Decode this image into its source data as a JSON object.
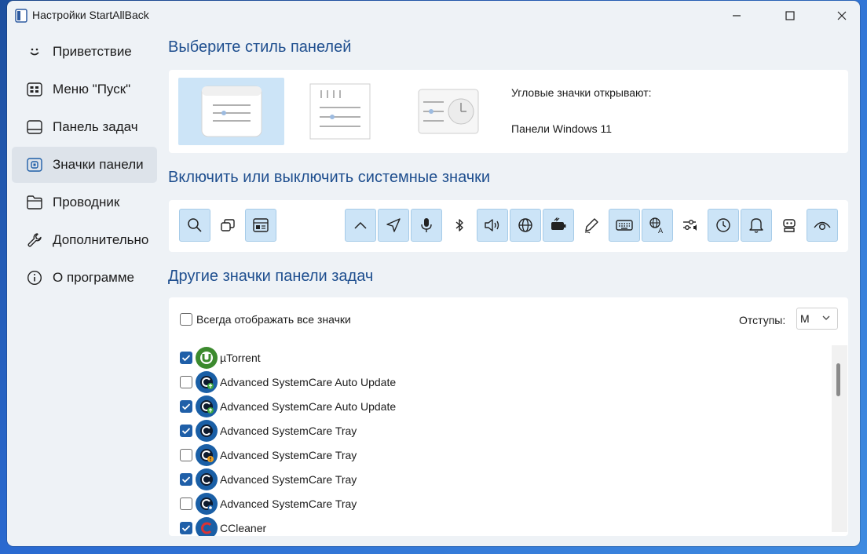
{
  "window": {
    "title": "Настройки StartAllBack"
  },
  "sidebar": {
    "items": [
      {
        "label": "Приветствие",
        "icon": "smile-icon",
        "active": false
      },
      {
        "label": "Меню \"Пуск\"",
        "icon": "start-menu-icon",
        "active": false
      },
      {
        "label": "Панель задач",
        "icon": "taskbar-icon",
        "active": false
      },
      {
        "label": "Значки панели",
        "icon": "tray-icon",
        "active": true
      },
      {
        "label": "Проводник",
        "icon": "folder-icon",
        "active": false
      },
      {
        "label": "Дополнительно",
        "icon": "wrench-icon",
        "active": false
      },
      {
        "label": "О программе",
        "icon": "info-icon",
        "active": false
      }
    ]
  },
  "style_section": {
    "title": "Выберите стиль панелей",
    "corner_label": "Угловые значки открывают:",
    "corner_value": "Панели Windows 11"
  },
  "system_icons": {
    "title": "Включить или выключить системные значки"
  },
  "other_icons": {
    "title": "Другие значки панели задач",
    "always_show_label": "Всегда отображать все значки",
    "spacing_label": "Отступы:",
    "spacing_value": "M",
    "items": [
      {
        "label": "µTorrent",
        "checked": true
      },
      {
        "label": "Advanced SystemCare Auto Update",
        "checked": false
      },
      {
        "label": "Advanced SystemCare Auto Update",
        "checked": true
      },
      {
        "label": "Advanced SystemCare Tray",
        "checked": true
      },
      {
        "label": "Advanced SystemCare Tray",
        "checked": false
      },
      {
        "label": "Advanced SystemCare Tray",
        "checked": true
      },
      {
        "label": "Advanced SystemCare Tray",
        "checked": false
      },
      {
        "label": "CCleaner",
        "checked": true
      }
    ]
  },
  "colors": {
    "accent": "#1f5fa8",
    "selected_bg": "#cce4f7",
    "heading": "#1f4f8f"
  }
}
